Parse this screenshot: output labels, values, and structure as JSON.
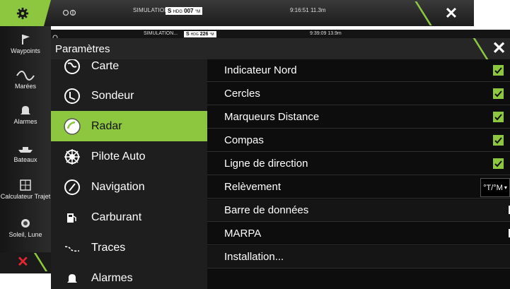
{
  "background_window": {
    "status": {
      "simulation": "SIMULATION...",
      "hdg_prefix": "S",
      "hdg_label": "HDG",
      "hdg_value": "007",
      "hdg_unit": "°M",
      "time": "9:16:51",
      "distance": "11.3m"
    },
    "sidebar": [
      {
        "label": "Waypoints",
        "icon": "flag-icon"
      },
      {
        "label": "Marées",
        "icon": "tide-wave-icon"
      },
      {
        "label": "Alarmes",
        "icon": "bell-icon"
      },
      {
        "label": "Bateaux",
        "icon": "boat-icon"
      },
      {
        "label": "Calculateur Trajet",
        "icon": "calculator-icon"
      },
      {
        "label": "Soleil, Lune",
        "icon": "sun-icon"
      }
    ]
  },
  "dialog": {
    "status": {
      "simulation": "SIMULATION...",
      "hdg_prefix": "S",
      "hdg_label": "HDG",
      "hdg_value": "226",
      "hdg_unit": "°M",
      "time": "9:39:09",
      "distance": "13.9m"
    },
    "title": "Paramètres",
    "categories": [
      {
        "label": "Carte",
        "icon": "chart-globe-icon"
      },
      {
        "label": "Sondeur",
        "icon": "sonar-icon"
      },
      {
        "label": "Radar",
        "icon": "radar-icon",
        "selected": true
      },
      {
        "label": "Pilote Auto",
        "icon": "helm-wheel-icon"
      },
      {
        "label": "Navigation",
        "icon": "compass-icon"
      },
      {
        "label": "Carburant",
        "icon": "fuel-pump-icon"
      },
      {
        "label": "Traces",
        "icon": "trail-icon"
      },
      {
        "label": "Alarmes",
        "icon": "bell-icon"
      }
    ],
    "options": [
      {
        "label": "Indicateur Nord",
        "control": "checkbox",
        "checked": true
      },
      {
        "label": "Cercles",
        "control": "checkbox",
        "checked": true
      },
      {
        "label": "Marqueurs Distance",
        "control": "checkbox",
        "checked": true
      },
      {
        "label": "Compas",
        "control": "checkbox",
        "checked": true
      },
      {
        "label": "Ligne de direction",
        "control": "checkbox",
        "checked": true
      },
      {
        "label": "Relèvement",
        "control": "dropdown",
        "value": "°T/°M"
      },
      {
        "label": "Barre de données",
        "control": "toggle"
      },
      {
        "label": "MARPA",
        "control": "toggle"
      },
      {
        "label": "Installation...",
        "control": "none"
      }
    ]
  },
  "colors": {
    "accent": "#8dc63f",
    "close_red": "#e3262f",
    "panel_dark": "#1e1e1e",
    "panel_black": "#0d0d0d"
  }
}
